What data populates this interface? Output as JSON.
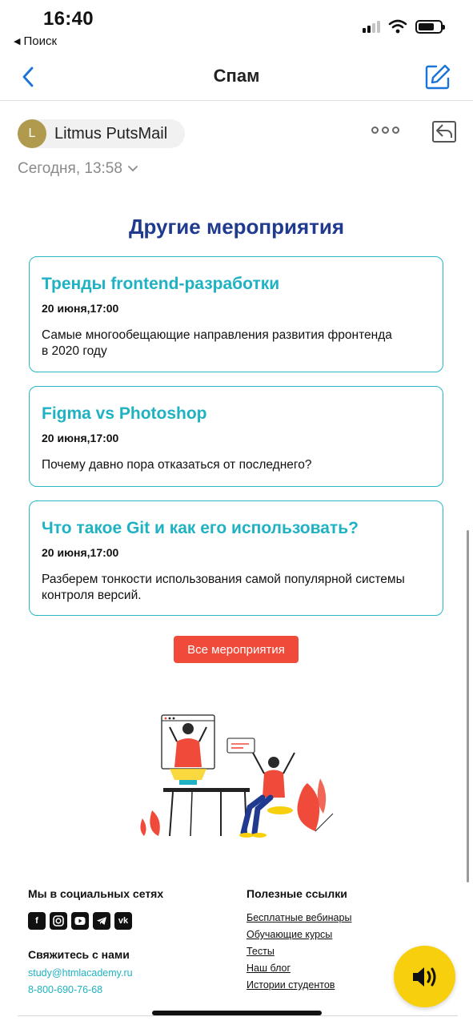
{
  "status": {
    "time": "16:40",
    "back_label": "Поиск"
  },
  "nav": {
    "title": "Спам"
  },
  "sender": {
    "avatar_letter": "L",
    "name": "Litmus PutsMail",
    "date": "Сегодня, 13:58"
  },
  "content": {
    "section_title": "Другие мероприятия",
    "events": [
      {
        "title": "Тренды frontend-разработки",
        "date": "20 июня,17:00",
        "desc_lines": [
          "Самые многообещающие направления развития фронтенда",
          "в 2020 году"
        ]
      },
      {
        "title": "Figma vs Photoshop",
        "date": "20 июня,17:00",
        "desc_lines": [
          "Почему давно пора отказаться от последнего?"
        ]
      },
      {
        "title": "Что такое Git и как его использовать?",
        "date": "20 июня,17:00",
        "desc_lines": [
          "Разберем тонкости использования самой популярной системы",
          "контроля версий."
        ]
      }
    ],
    "cta_label": "Все мероприятия"
  },
  "footer": {
    "social_heading": "Мы в социальных сетях",
    "social_icons": [
      "facebook-icon",
      "instagram-icon",
      "youtube-icon",
      "telegram-icon",
      "vk-icon"
    ],
    "contact_heading": "Свяжитесь с нами",
    "email": "study@htmlacademy.ru",
    "phone": "8-800-690-76-68",
    "links_heading": "Полезные ссылки",
    "links": [
      "Бесплатные вебинары",
      "Обучающие курсы",
      "Тесты",
      "Наш блог",
      "Истории студентов"
    ]
  },
  "colors": {
    "accent_blue": "#1f3a8f",
    "teal": "#1fb2c2",
    "cta_red": "#f04b3a",
    "audio_yellow": "#f8cf0d",
    "ios_blue": "#1a73d9"
  }
}
